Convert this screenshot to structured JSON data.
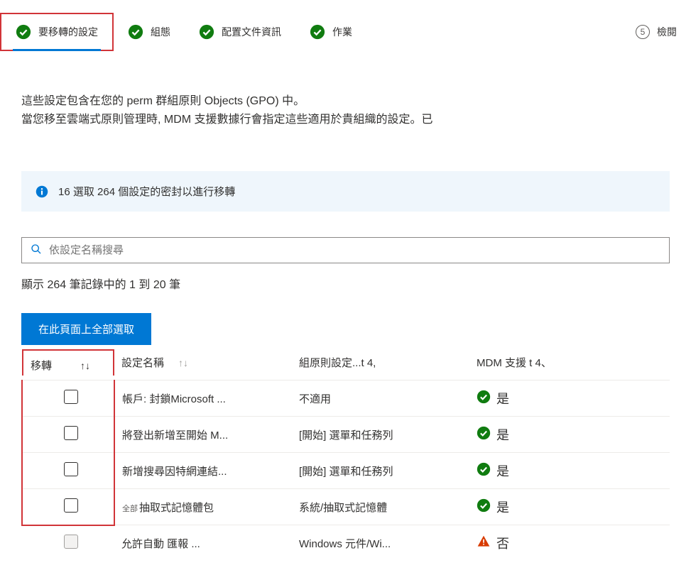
{
  "wizard": {
    "steps": [
      {
        "label": "要移轉的設定",
        "status": "done",
        "active": true
      },
      {
        "label": "組態",
        "status": "done",
        "active": false
      },
      {
        "label": "配置文件資訊",
        "status": "done",
        "active": false
      },
      {
        "label": "作業",
        "status": "done",
        "active": false
      },
      {
        "label": "檢閱",
        "status": "number",
        "number": "5",
        "active": false
      }
    ]
  },
  "description": {
    "line1": "這些設定包含在您的 perm 群組原則 Objects (GPO) 中。",
    "line2": "當您移至雲端式原則管理時, MDM 支援數據行會指定這些適用於貴組織的設定。已"
  },
  "info_bar": {
    "text": "16 選取 264 個設定的密封以進行移轉"
  },
  "search": {
    "placeholder": "依設定名稱搜尋"
  },
  "records_text": "顯示 264 筆記錄中的 1 到 20 筆",
  "select_all_label": "在此頁面上全部選取",
  "table": {
    "headers": {
      "migrate": "移轉",
      "setting": "設定名稱",
      "gpo": "組原則設定...t 4,",
      "mdm": "MDM 支援 t 4、"
    },
    "rows": [
      {
        "setting": "帳戶: 封鎖Microsoft ...",
        "gpo": "不適用",
        "mdm": "是",
        "mdm_status": "yes",
        "checkbox_enabled": true,
        "prefix": ""
      },
      {
        "setting": "將登出新增至開始 M...",
        "gpo": "[開始] 選單和任務列",
        "mdm": "是",
        "mdm_status": "yes",
        "checkbox_enabled": true,
        "prefix": ""
      },
      {
        "setting": "新增搜尋因特網連結...",
        "gpo": "[開始] 選單和任務列",
        "mdm": "是",
        "mdm_status": "yes",
        "checkbox_enabled": true,
        "prefix": ""
      },
      {
        "setting": "抽取式記憶體包",
        "gpo": "系統/抽取式記憶體",
        "mdm": "是",
        "mdm_status": "yes",
        "checkbox_enabled": true,
        "prefix": "全部"
      },
      {
        "setting": "允許自動 匯報 ...",
        "gpo": "Windows 元件/Wi...",
        "mdm": "否",
        "mdm_status": "no",
        "checkbox_enabled": false,
        "prefix": ""
      }
    ]
  }
}
